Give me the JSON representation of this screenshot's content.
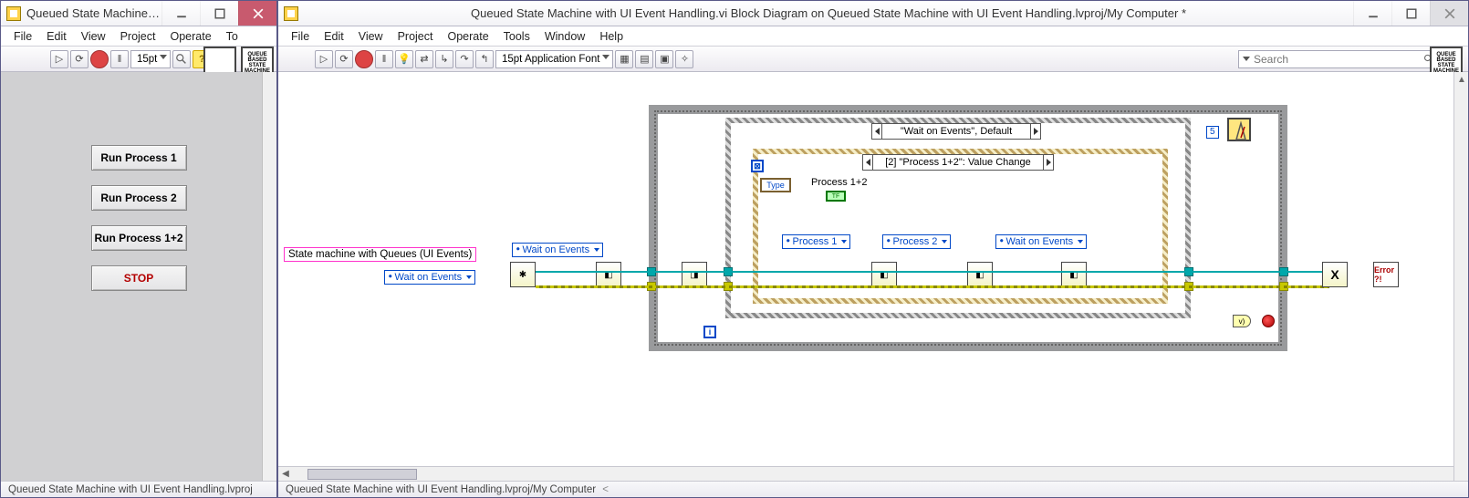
{
  "left": {
    "title": "Queued State Machine wit...",
    "menu": [
      "File",
      "Edit",
      "View",
      "Project",
      "Operate",
      "To"
    ],
    "font": "15pt",
    "buttons": {
      "p1": "Run Process 1",
      "p2": "Run Process 2",
      "p12": "Run Process 1+2",
      "stop": "STOP"
    },
    "status": "Queued State Machine with UI Event Handling.lvproj",
    "icon_text": "QUEUE BASED STATE MACHINE"
  },
  "right": {
    "title": "Queued State Machine with UI Event Handling.vi Block Diagram on Queued State Machine with UI Event Handling.lvproj/My Computer *",
    "menu": [
      "File",
      "Edit",
      "View",
      "Project",
      "Operate",
      "Tools",
      "Window",
      "Help"
    ],
    "font": "15pt Application Font",
    "search_placeholder": "Search",
    "status": "Queued State Machine with UI Event Handling.lvproj/My Computer",
    "icon_text": "QUEUE BASED STATE MACHINE"
  },
  "diagram": {
    "queue_label": "State machine with Queues (UI Events)",
    "init_state": "Wait on Events",
    "init_state2": "Wait on Events",
    "case_selector": "\"Wait on Events\", Default",
    "event_selector": "[2] \"Process 1+2\": Value Change",
    "event_type": "Type",
    "event_source_label": "Process 1+2",
    "bool_ind": "TF",
    "enq_states": [
      "Process 1",
      "Process 2",
      "Wait on Events"
    ],
    "wait_ms": "5",
    "loop_i": "i",
    "error_tag": "Error ?!",
    "or_label": "v)"
  }
}
